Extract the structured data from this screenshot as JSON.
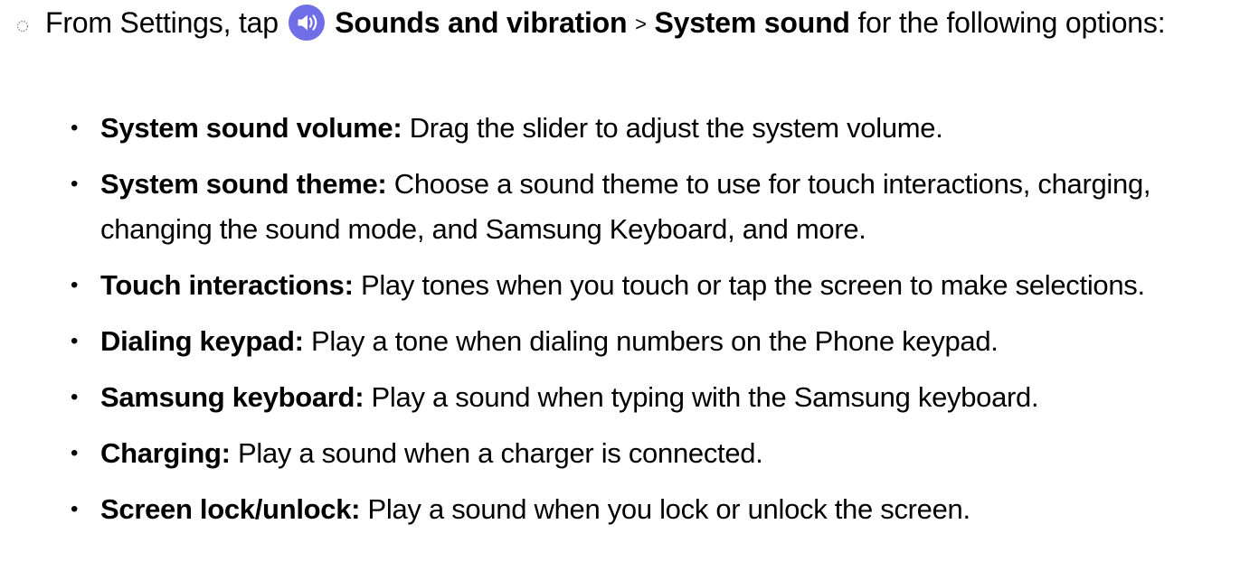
{
  "step": {
    "marker_icon": "dotted-circle-icon",
    "intro": "From Settings, tap",
    "settings_icon": "speaker-icon",
    "settings_icon_color": "#6f6ee6",
    "menu_path_1": "Sounds and vibration",
    "separator": ">",
    "menu_path_2": "System sound",
    "outro": "for the following options:"
  },
  "options": [
    {
      "label": "System sound volume",
      "colon": ":",
      "description": "Drag the slider to adjust the system volume."
    },
    {
      "label": "System sound theme",
      "colon": ":",
      "description": "Choose a sound theme to use for touch interactions, charging, changing the sound mode, and Samsung Keyboard, and more."
    },
    {
      "label": "Touch interactions",
      "colon": ":",
      "description": "Play tones when you touch or tap the screen to make selections."
    },
    {
      "label": "Dialing keypad",
      "colon": ":",
      "description": "Play a tone when dialing numbers on the Phone keypad."
    },
    {
      "label": "Samsung keyboard",
      "colon": ":",
      "description": "Play a sound when typing with the Samsung keyboard."
    },
    {
      "label": "Charging",
      "colon": ":",
      "description": "Play a sound when a charger is connected."
    },
    {
      "label": "Screen lock/unlock",
      "colon": ":",
      "description": "Play a sound when you lock or unlock the screen."
    }
  ],
  "bullet": "•"
}
